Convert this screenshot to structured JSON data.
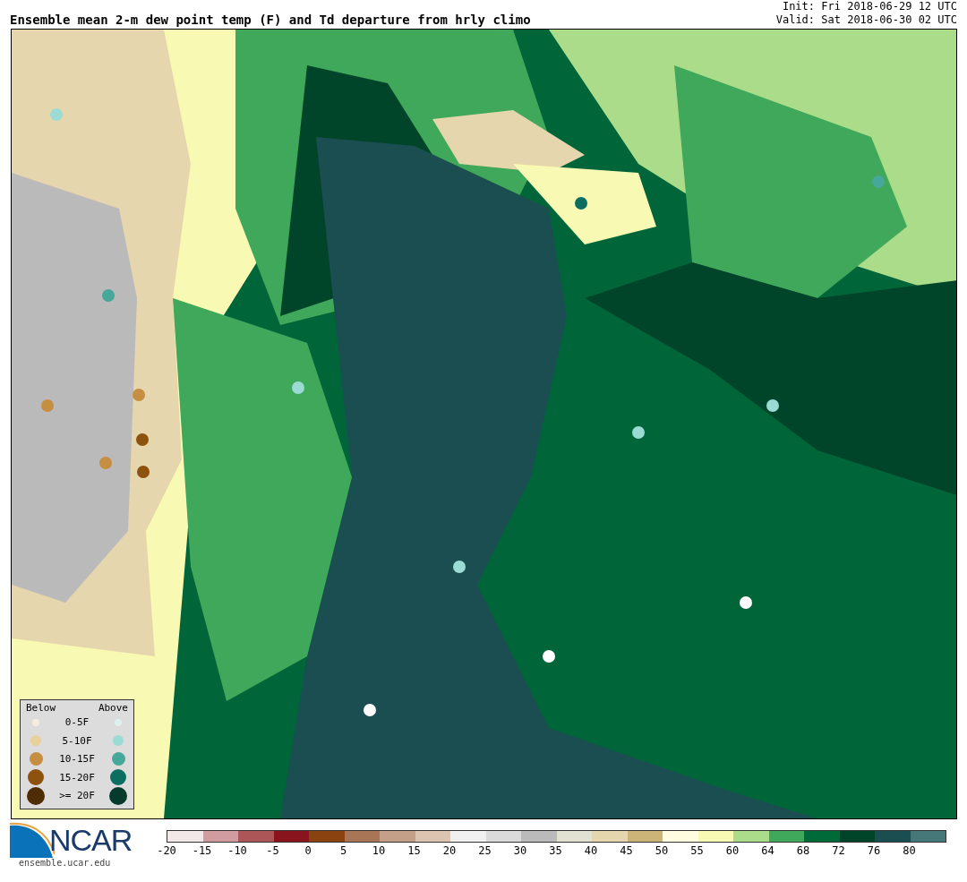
{
  "title": "Ensemble mean 2-m dew point temp (F) and Td departure from hrly climo",
  "init": "Init: Fri 2018-06-29 12 UTC",
  "valid": "Valid: Sat 2018-06-30 02 UTC",
  "legend": {
    "below_label": "Below",
    "above_label": "Above",
    "rows": [
      {
        "label": "0-5F",
        "below": {
          "color": "#f5ecdc"
        },
        "above": {
          "color": "#dcf0ee"
        }
      },
      {
        "label": "5-10F",
        "below": {
          "color": "#e8d09a"
        },
        "above": {
          "color": "#9adbd3"
        }
      },
      {
        "label": "10-15F",
        "below": {
          "color": "#c68e40"
        },
        "above": {
          "color": "#46a89a"
        }
      },
      {
        "label": "15-20F",
        "below": {
          "color": "#8e520f"
        },
        "above": {
          "color": "#0b6e5e"
        }
      },
      {
        "label": ">= 20F",
        "below": {
          "color": "#4e2c06"
        },
        "above": {
          "color": "#053a2c"
        }
      }
    ]
  },
  "logo": {
    "name": "NCAR",
    "url": "ensemble.ucar.edu"
  },
  "colorbar": [
    {
      "label": "-20",
      "color": "#f2e8e8"
    },
    {
      "label": "-15",
      "color": "#d09ca0"
    },
    {
      "label": "-10",
      "color": "#ac5658"
    },
    {
      "label": "-5",
      "color": "#8a141e"
    },
    {
      "label": "0",
      "color": "#8a4210"
    },
    {
      "label": "5",
      "color": "#a87656"
    },
    {
      "label": "10",
      "color": "#c4a088"
    },
    {
      "label": "15",
      "color": "#dcc4b0"
    },
    {
      "label": "20",
      "color": "#f0f0f0"
    },
    {
      "label": "25",
      "color": "#dadada"
    },
    {
      "label": "30",
      "color": "#bababa"
    },
    {
      "label": "35",
      "color": "#e2e2d2"
    },
    {
      "label": "40",
      "color": "#e6d6ae"
    },
    {
      "label": "45",
      "color": "#ccb478"
    },
    {
      "label": "50",
      "color": "#fffde0"
    },
    {
      "label": "55",
      "color": "#f8fab4"
    },
    {
      "label": "60",
      "color": "#aadc8a"
    },
    {
      "label": "64",
      "color": "#40a85a"
    },
    {
      "label": "68",
      "color": "#006a38"
    },
    {
      "label": "72",
      "color": "#00452a"
    },
    {
      "label": "76",
      "color": "#1a4e50"
    },
    {
      "label": "80",
      "color": "#46787a"
    }
  ]
}
